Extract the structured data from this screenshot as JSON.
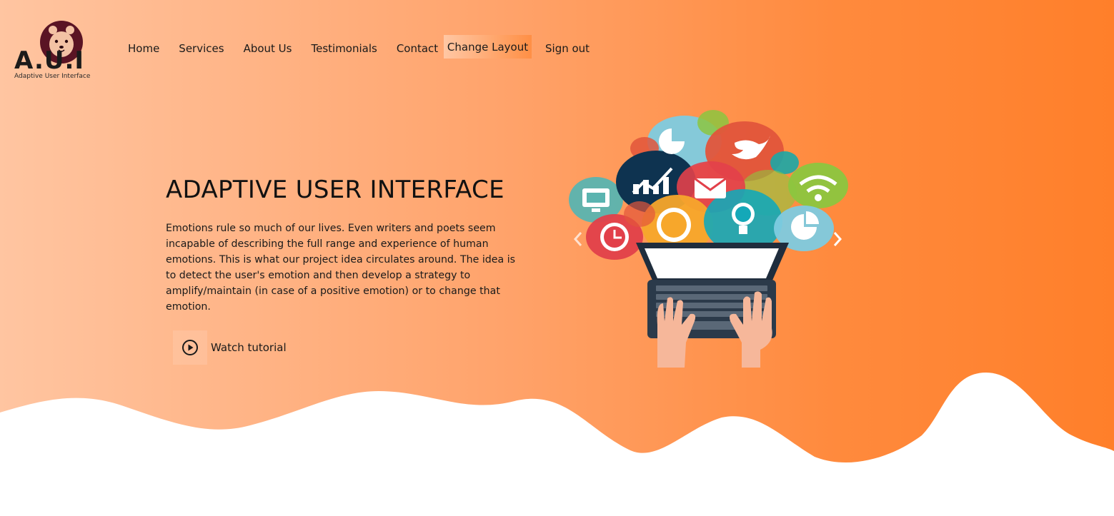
{
  "logo": {
    "text": "A.U.I",
    "subtitle": "Adaptive User Interface"
  },
  "nav": {
    "items": [
      "Home",
      "Services",
      "About Us",
      "Testimonials",
      "Contact"
    ],
    "change_layout": "Change Layout",
    "sign_out": "Sign out"
  },
  "hero": {
    "title": "ADAPTIVE USER INTERFACE",
    "description": "Emotions rule so much of our lives. Even writers and poets seem incapable of describing the full range and experience of human emotions. This is what our project idea circulates around. The idea is to detect the user's emotion and then develop a strategy to amplify/maintain (in case of a positive emotion) or to change that emotion.",
    "watch_label": "Watch tutorial"
  },
  "carousel": {
    "prev_icon": "chevron-left-icon",
    "next_icon": "chevron-right-icon"
  },
  "colors": {
    "gradient_start": "#ffc5a1",
    "gradient_end": "#ff7f2a",
    "text": "#1a1a1a"
  }
}
